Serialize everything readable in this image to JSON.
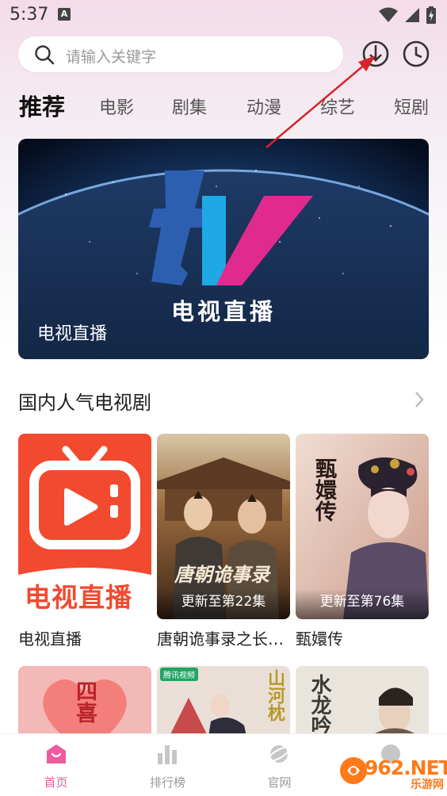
{
  "status_bar": {
    "time": "5:37",
    "badge": "A"
  },
  "search": {
    "placeholder": "请输入关键字"
  },
  "tabs": [
    {
      "label": "推荐",
      "active": true
    },
    {
      "label": "电影"
    },
    {
      "label": "剧集"
    },
    {
      "label": "动漫"
    },
    {
      "label": "综艺"
    },
    {
      "label": "短剧"
    }
  ],
  "banner": {
    "title": "电视直播",
    "caption": "电视直播",
    "logo_text": "tv"
  },
  "section": {
    "title": "国内人气电视剧"
  },
  "cards": [
    {
      "title": "电视直播",
      "update": "",
      "poster_text": "电视直播"
    },
    {
      "title": "唐朝诡事录之长…",
      "update": "更新至第22集",
      "poster_text": "唐朝诡事录"
    },
    {
      "title": "甄嬛传",
      "update": "更新至第76集",
      "poster_text": "甄嬛传"
    }
  ],
  "cards_row2": [
    {
      "poster_text": "四喜"
    },
    {
      "poster_text": "山河枕",
      "badge": "腾讯视频"
    },
    {
      "poster_text": "水龙吟"
    }
  ],
  "bottom_nav": [
    {
      "label": "首页",
      "icon": "home-icon",
      "active": true
    },
    {
      "label": "排行榜",
      "icon": "ranking-icon"
    },
    {
      "label": "官网",
      "icon": "planet-icon"
    },
    {
      "label": "",
      "icon": "profile-icon"
    }
  ],
  "watermark": {
    "text": "962.NET",
    "sub": "乐游网"
  },
  "colors": {
    "accent": "#ee5a9e",
    "annotation_arrow": "#d9232a"
  }
}
